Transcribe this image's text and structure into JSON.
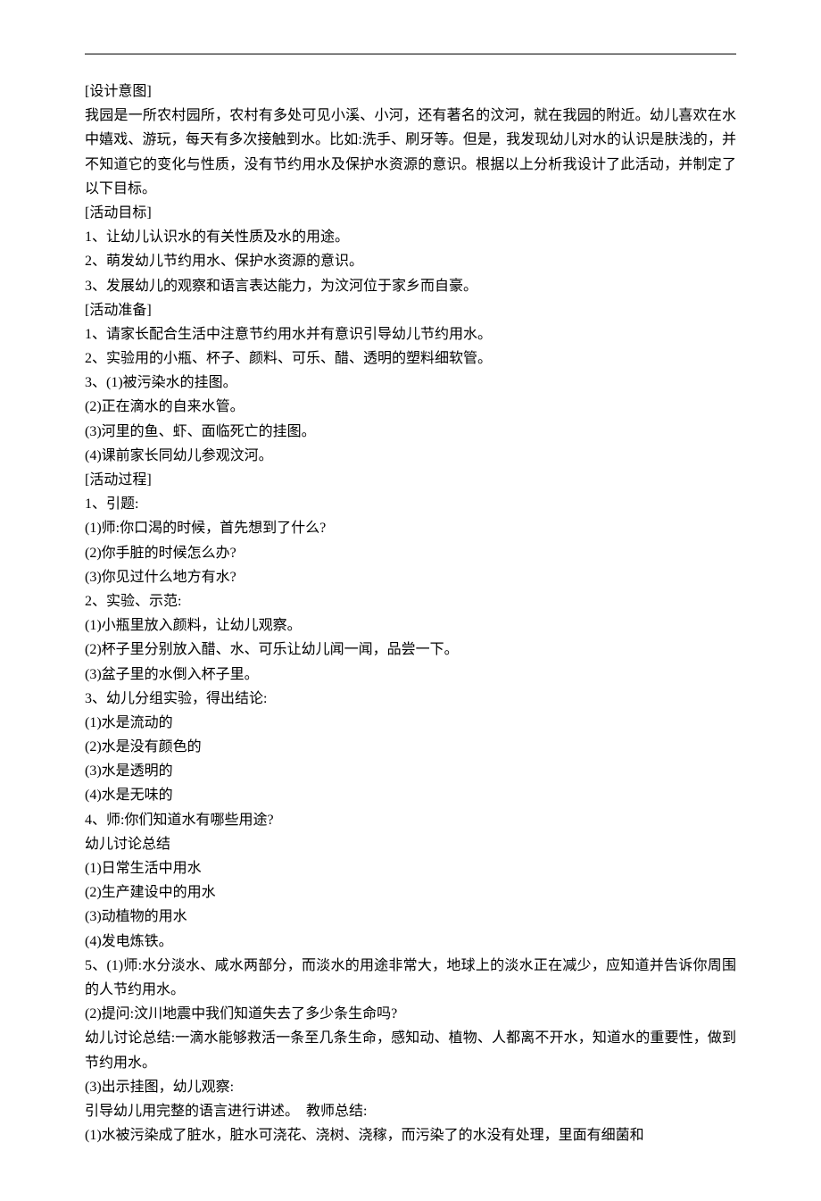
{
  "sections": {
    "design_intent_header": "[设计意图]",
    "design_intent_body": "我园是一所农村园所，农村有多处可见小溪、小河，还有著名的汶河，就在我园的附近。幼儿喜欢在水中嬉戏、游玩，每天有多次接触到水。比如:洗手、刷牙等。但是，我发现幼儿对水的认识是肤浅的，并不知道它的变化与性质，没有节约用水及保护水资源的意识。根据以上分析我设计了此活动，并制定了以下目标。",
    "goals_header": "[活动目标]",
    "goals": [
      "1、让幼儿认识水的有关性质及水的用途。",
      "2、萌发幼儿节约用水、保护水资源的意识。",
      "3、发展幼儿的观察和语言表达能力，为汶河位于家乡而自豪。"
    ],
    "prep_header": "[活动准备]",
    "prep_items": [
      "1、请家长配合生活中注意节约用水并有意识引导幼儿节约用水。",
      "2、实验用的小瓶、杯子、颜料、可乐、醋、透明的塑料细软管。",
      "3、(1)被污染水的挂图。",
      "(2)正在滴水的自来水管。",
      "(3)河里的鱼、虾、面临死亡的挂图。",
      "(4)课前家长同幼儿参观汶河。"
    ],
    "process_header": "[活动过程]",
    "step1_header": "1、引题:",
    "step1_items": [
      "(1)师:你口渴的时候，首先想到了什么?",
      "(2)你手脏的时候怎么办?",
      "(3)你见过什么地方有水?"
    ],
    "step2_header": "2、实验、示范:",
    "step2_items": [
      "(1)小瓶里放入颜料，让幼儿观察。",
      "(2)杯子里分别放入醋、水、可乐让幼儿闻一闻，品尝一下。",
      "(3)盆子里的水倒入杯子里。"
    ],
    "step3_header": "3、幼儿分组实验，得出结论:",
    "step3_items": [
      "(1)水是流动的",
      "(2)水是没有颜色的",
      "(3)水是透明的",
      "(4)水是无味的"
    ],
    "step4_header": "4、师:你们知道水有哪些用途?",
    "step4_sub": "幼儿讨论总结",
    "step4_items": [
      "(1)日常生活中用水",
      "(2)生产建设中的用水",
      "(3)动植物的用水",
      "(4)发电炼铁。"
    ],
    "step5_1": "5、(1)师:水分淡水、咸水两部分，而淡水的用途非常大，地球上的淡水正在减少，应知道并告诉你周围的人节约用水。",
    "step5_2": "(2)提问:汶川地震中我们知道失去了多少条生命吗?",
    "step5_3": "幼儿讨论总结:一滴水能够救活一条至几条生命，感知动、植物、人都离不开水，知道水的重要性，做到节约用水。",
    "step5_4": "(3)出示挂图，幼儿观察:",
    "step5_5": "引导幼儿用完整的语言进行讲述。  教师总结:",
    "step5_6": "(1)水被污染成了脏水，脏水可浇花、浇树、浇稼，而污染了的水没有处理，里面有细菌和"
  }
}
